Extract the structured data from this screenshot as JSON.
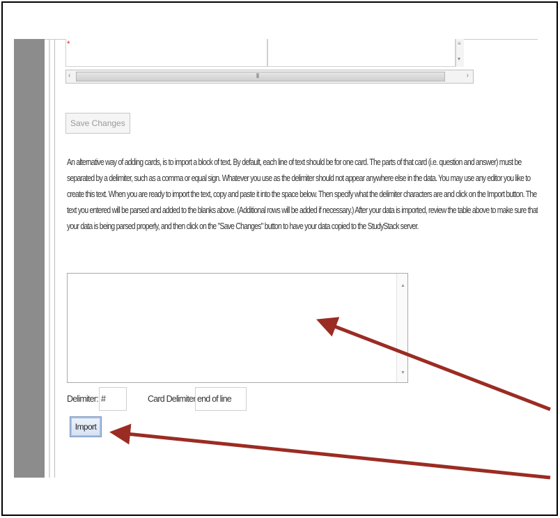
{
  "save_button": {
    "label": "Save Changes"
  },
  "instructions": "An alternative way of adding cards, is to import a block of text. By default, each line of text should be for one card. The parts of that card (i.e. question and answer) must be separated by a delimiter, such as a comma or equal sign. Whatever you use as the delimiter should not appear anywhere else in the data. You may use any editor you like to create this text. When you are ready to import the text, copy and paste it into the space below. Then specify what the delimiter characters are and click on the Import button. The text you entered will be parsed and added to the blanks above. (Additional rows will be added if necessary.) After your data is imported, review the table above to make sure that your data is being parsed properly, and then click on the \"Save Changes\" button to have your data copied to the StudyStack server.",
  "delimiter": {
    "label": "Delimiter:",
    "value": "#"
  },
  "card_delimiter": {
    "label": "Card Delimiter:",
    "value": "end of line"
  },
  "import_button": {
    "label": "Import"
  },
  "grid": {
    "red_marker": "*"
  },
  "colors": {
    "arrow": "#9b2c23",
    "sidebar": "#8c8c8c"
  }
}
